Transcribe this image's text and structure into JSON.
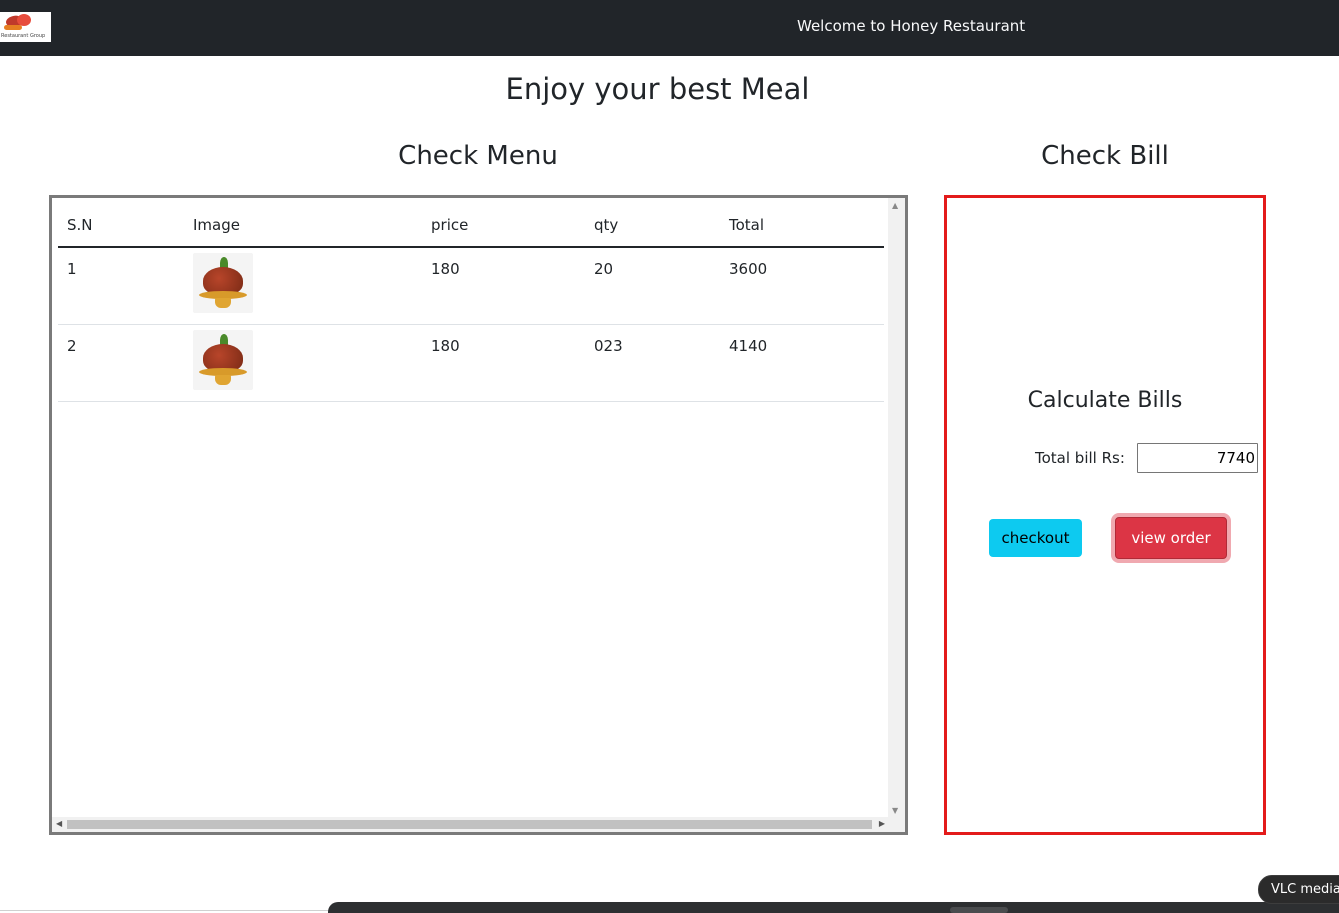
{
  "navbar": {
    "logo_text": "Restaurant Group",
    "welcome": "Welcome to Honey Restaurant"
  },
  "page_title": "Enjoy your best Meal",
  "menu": {
    "title": "Check Menu",
    "columns": [
      "S.N",
      "Image",
      "price",
      "qty",
      "Total"
    ],
    "rows": [
      {
        "sn": "1",
        "image": "food-image",
        "price": "180",
        "qty": "20",
        "total": "3600"
      },
      {
        "sn": "2",
        "image": "food-image",
        "price": "180",
        "qty": "023",
        "total": "4140"
      }
    ]
  },
  "bill": {
    "title": "Check Bill",
    "calc_title": "Calculate Bills",
    "total_label": "Total bill Rs:",
    "total_value": "7740",
    "checkout_label": "checkout",
    "view_order_label": "view order"
  },
  "taskbar": {
    "tooltip": "VLC media player"
  },
  "colors": {
    "navbar": "#212529",
    "bill_border": "#e31b1b",
    "checkout_btn": "#0dcaf0",
    "view_order_btn": "#dc3545"
  }
}
